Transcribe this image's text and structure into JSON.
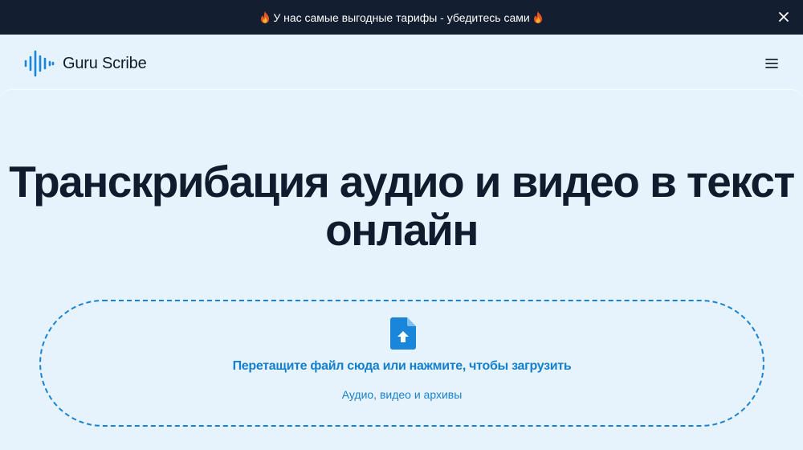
{
  "promo": {
    "text": "У нас самые выгодные тарифы - убедитесь сами",
    "left_icon": "fire-icon",
    "right_icon": "fire-icon",
    "close_icon": "close-icon"
  },
  "header": {
    "brand": "Guru Scribe",
    "logo_icon": "sound-wave-logo-icon",
    "menu_icon": "hamburger-menu-icon"
  },
  "hero": {
    "title_line1": "Транскрибация аудио и видео в текст",
    "title_line2": "онлайн"
  },
  "upload": {
    "icon": "file-upload-icon",
    "title": "Перетащите файл сюда или нажмите, чтобы загрузить",
    "subtitle": "Аудио, видео и архивы"
  },
  "colors": {
    "background": "#e6f3fc",
    "promo_bar": "#131e30",
    "accent": "#1883d4",
    "text_dark": "#101b2d"
  }
}
